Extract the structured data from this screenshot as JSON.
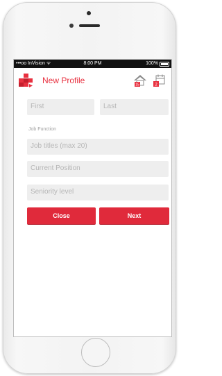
{
  "status_bar": {
    "carrier": "•••oo InVision ",
    "time": "8:00 PM",
    "battery": "100%"
  },
  "header": {
    "title": "New Profile",
    "home_badge": "15",
    "calendar_badge": "2",
    "brand_color": "#e8303f"
  },
  "form": {
    "first_placeholder": "First",
    "last_placeholder": "Last",
    "section_label": "Job Function",
    "job_titles_placeholder": "Job titles (max 20)",
    "current_position_placeholder": "Current Position",
    "seniority_placeholder": "Seniority level"
  },
  "actions": {
    "close_label": "Close",
    "next_label": "Next"
  }
}
